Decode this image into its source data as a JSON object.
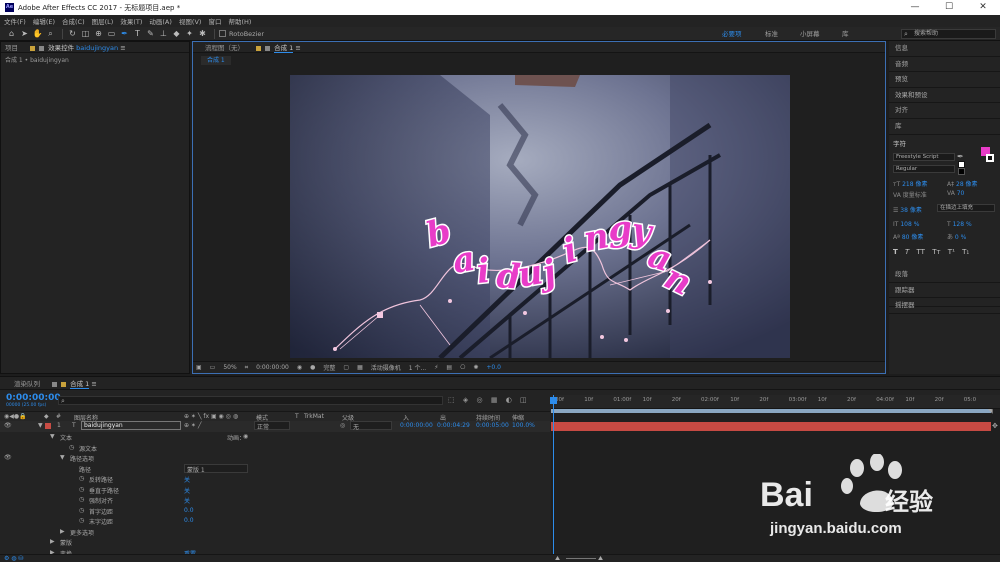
{
  "window": {
    "title": "Adobe After Effects CC 2017 - 无标题项目.aep *",
    "app_badge": "Ae",
    "minimize": "—",
    "maximize": "☐",
    "close": "✕"
  },
  "menu": [
    "文件(F)",
    "编辑(E)",
    "合成(C)",
    "图层(L)",
    "效果(T)",
    "动画(A)",
    "视图(V)",
    "窗口",
    "帮助(H)"
  ],
  "toolbar": {
    "rotobezier": "RotoBezier",
    "workspaces": [
      "必要项",
      "标准",
      "小屏幕",
      "库"
    ],
    "search_placeholder": "搜索帮助"
  },
  "project_panel": {
    "tab_project": "项目",
    "tab_effects": "效果控件",
    "effects_layer": "baidujingyan",
    "breadcrumb": "合成 1 • baidujingyan"
  },
  "viewer": {
    "tab_flow": "流程图（无）",
    "tab_comp": "合成 1",
    "subtab": "合成 1",
    "zoom": "50%",
    "timecode": "0:00:00:00",
    "resolution": "完整",
    "camera": "活动摄像机",
    "views": "1 个...",
    "exposure": "+0.0",
    "text_on_path": [
      "b",
      "a",
      "i",
      "d",
      "u",
      "j",
      "i",
      "n",
      "g",
      "y",
      "a",
      "n"
    ]
  },
  "right_panels": {
    "items_top": [
      "信息",
      "音频",
      "预览",
      "效果和预设",
      "对齐",
      "库"
    ],
    "character": {
      "title": "字符",
      "font": "Freestyle Script",
      "style": "Regular",
      "size": "218 像素",
      "leading": "28 像素",
      "kerning": "度量标准",
      "tracking": "70",
      "stroke_width": "38 像素",
      "stroke_mode": "在描边上填充",
      "vscale": "108 %",
      "hscale": "128 %",
      "baseline": "80 像素",
      "tsume": "0 %",
      "styles": [
        "T",
        "T",
        "TT",
        "Tт",
        "T¹",
        "T₁"
      ],
      "fill_color": "#e83cc8",
      "stroke_color": "#ffffff"
    },
    "items_bottom": [
      "段落",
      "跟踪器",
      "摇摆器"
    ]
  },
  "timeline": {
    "tab_render": "渲染队列",
    "tab_comp": "合成 1",
    "timecode": "0:00:00:00",
    "timecode_sub": "00000 (25.00 fps)",
    "columns": {
      "name": "图层名称",
      "mode": "模式",
      "t": "T",
      "trkmat": "TrkMat",
      "parent": "父级",
      "in": "入",
      "out": "出",
      "duration": "持续时间",
      "stretch": "伸缩"
    },
    "layer": {
      "index": "1",
      "type": "T",
      "name": "baidujingyan",
      "mode": "正常",
      "parent": "无",
      "in": "0:00:00:00",
      "out": "0:00:04:29",
      "duration": "0:00:05:00",
      "stretch": "100.0%"
    },
    "props": {
      "text": "文本",
      "animate": "动画：",
      "source_text": "源文本",
      "path_options": "路径选项",
      "path": "路径",
      "path_value": "蒙版 1",
      "reverse_path": "反转路径",
      "reverse_value": "关",
      "perpendicular": "垂直于路径",
      "perpendicular_value": "关",
      "force_align": "强制对齐",
      "force_value": "关",
      "first_margin": "首字边距",
      "first_value": "0.0",
      "last_margin": "末字边距",
      "last_value": "0.0",
      "more_options": "更多选项",
      "masks": "蒙版",
      "transform": "变换",
      "reset": "重置"
    },
    "ruler": [
      "00f",
      "10f",
      "01:00f",
      "10f",
      "20f",
      "02:00f",
      "10f",
      "20f",
      "03:00f",
      "10f",
      "20f",
      "04:00f",
      "10f",
      "20f",
      "05:0"
    ]
  },
  "watermark": {
    "brand": "Bai",
    "brand2": "经验",
    "url": "jingyan.baidu.com"
  }
}
